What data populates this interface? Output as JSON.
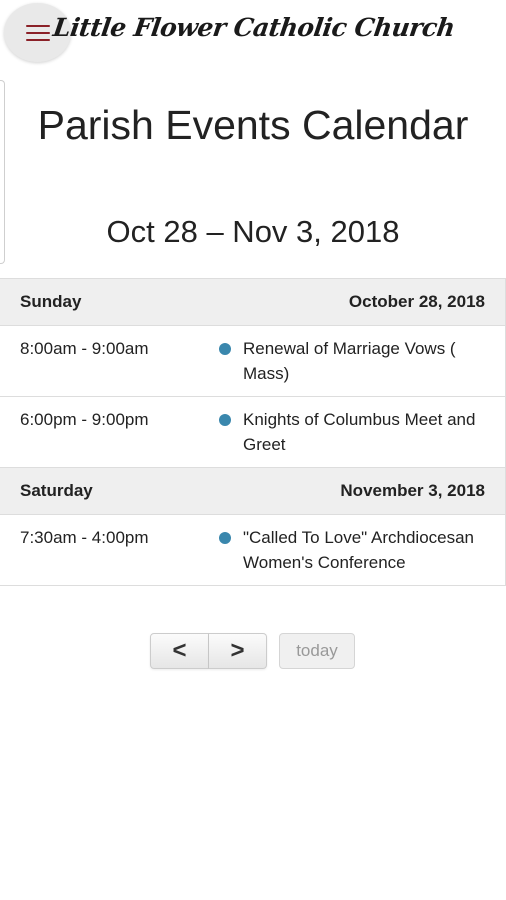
{
  "header": {
    "logo_text": "Little Flower Catholic Church",
    "menu_icon": "hamburger-menu-icon",
    "accent_color": "#8b2128"
  },
  "page": {
    "title": "Parish Events Calendar",
    "date_range": "Oct 28 – Nov 3, 2018"
  },
  "days": [
    {
      "day": "Sunday",
      "date": "October 28, 2018",
      "events": [
        {
          "time": "8:00am - 9:00am",
          "title": "Renewal of Marriage Vows ( Mass)"
        },
        {
          "time": "6:00pm - 9:00pm",
          "title": "Knights of Columbus Meet and Greet"
        }
      ]
    },
    {
      "day": "Saturday",
      "date": "November 3, 2018",
      "events": [
        {
          "time": "7:30am - 4:00pm",
          "title": "\"Called To Love\" Archdiocesan Women's Conference"
        }
      ]
    }
  ],
  "nav": {
    "prev_label": "<",
    "next_label": ">",
    "today_label": "today"
  },
  "colors": {
    "event_dot": "#3a87ad",
    "day_header_bg": "#efefef"
  }
}
